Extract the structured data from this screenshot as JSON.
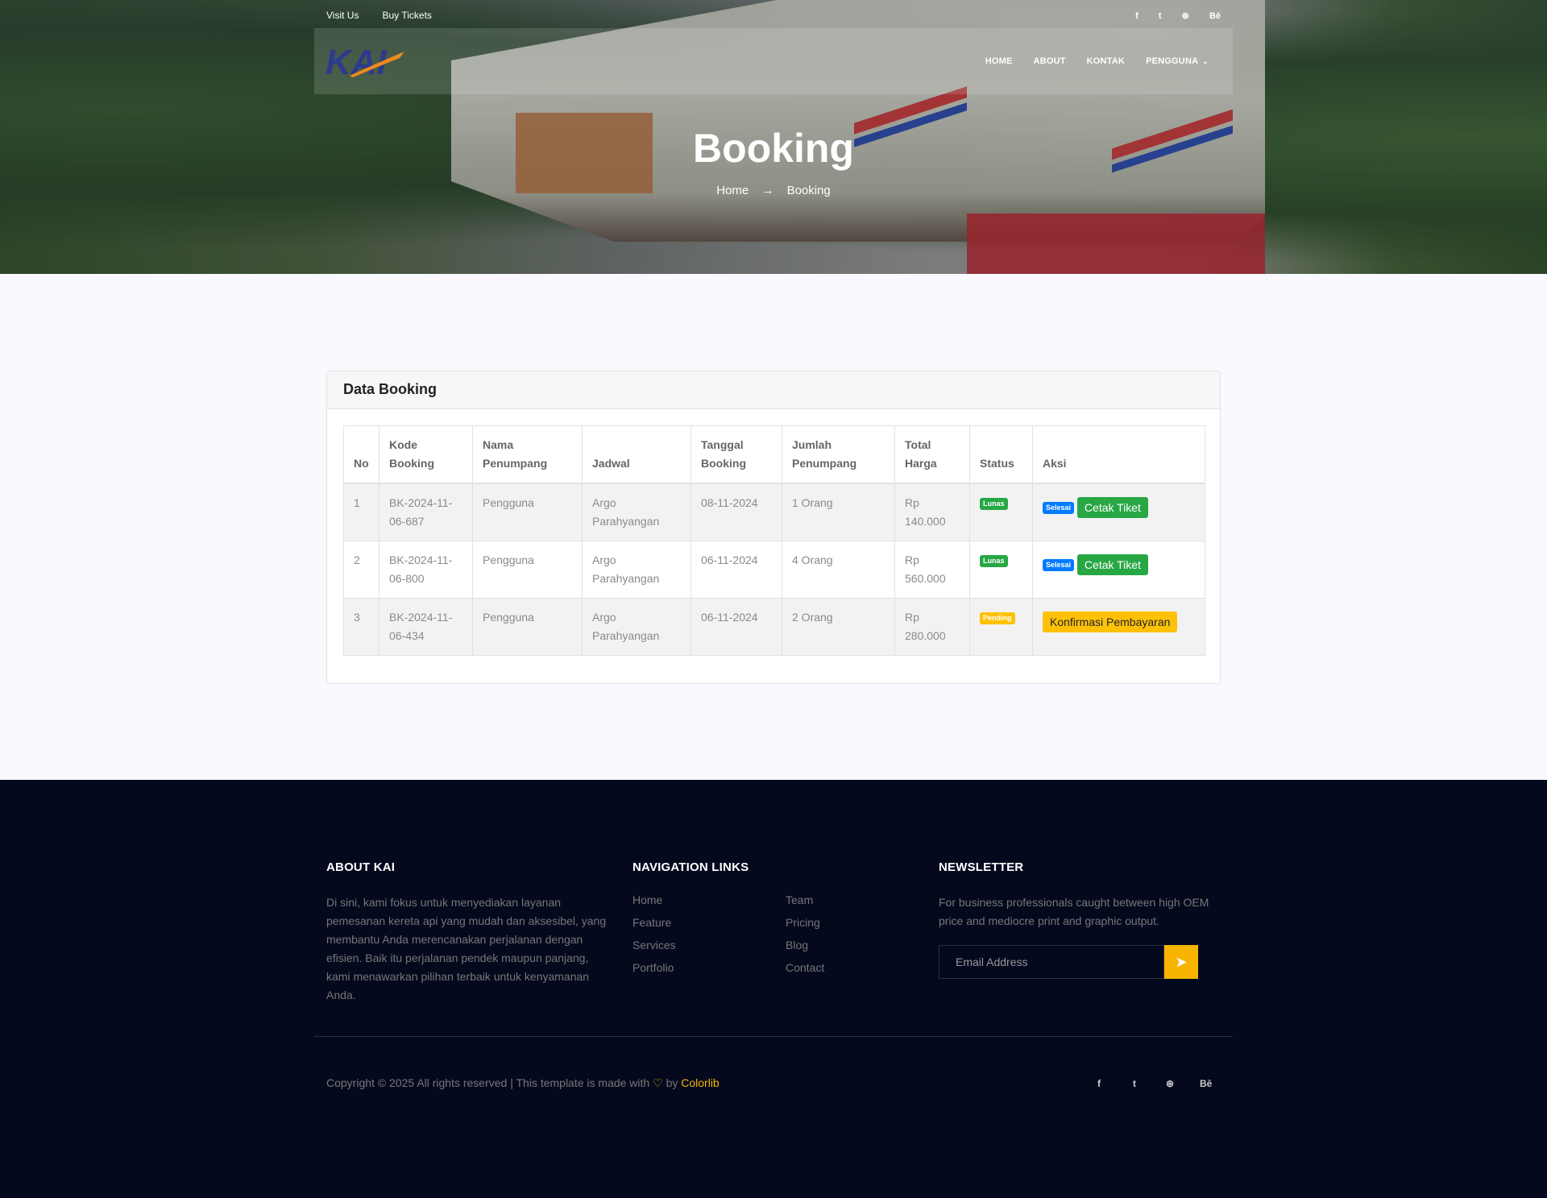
{
  "topbar": {
    "links": [
      "Visit Us",
      "Buy Tickets"
    ],
    "social": [
      {
        "icon": "facebook-icon",
        "glyph": "f"
      },
      {
        "icon": "twitter-icon",
        "glyph": "t"
      },
      {
        "icon": "dribbble-icon",
        "glyph": "⊛"
      },
      {
        "icon": "behance-icon",
        "glyph": "Bē"
      }
    ]
  },
  "nav": {
    "logo_text": "KAI",
    "items": [
      "HOME",
      "ABOUT",
      "KONTAK",
      "PENGGUNA"
    ]
  },
  "hero": {
    "title": "Booking",
    "breadcrumb_home": "Home",
    "breadcrumb_current": "Booking"
  },
  "card": {
    "title": "Data Booking",
    "columns": [
      "No",
      "Kode Booking",
      "Nama Penumpang",
      "Jadwal",
      "Tanggal Booking",
      "Jumlah Penumpang",
      "Total Harga",
      "Status",
      "Aksi"
    ],
    "rows": [
      {
        "no": "1",
        "kode": "BK-2024-11-06-687",
        "nama": "Pengguna",
        "jadwal": "Argo Parahyangan",
        "tanggal": "08-11-2024",
        "jumlah": "1 Orang",
        "harga": "Rp 140.000",
        "status": "Lunas",
        "status_color": "#28a745",
        "aksi_badge": "Selesai",
        "aksi_button": "Cetak Tiket"
      },
      {
        "no": "2",
        "kode": "BK-2024-11-06-800",
        "nama": "Pengguna",
        "jadwal": "Argo Parahyangan",
        "tanggal": "06-11-2024",
        "jumlah": "4 Orang",
        "harga": "Rp 560.000",
        "status": "Lunas",
        "status_color": "#28a745",
        "aksi_badge": "Selesai",
        "aksi_button": "Cetak Tiket"
      },
      {
        "no": "3",
        "kode": "BK-2024-11-06-434",
        "nama": "Pengguna",
        "jadwal": "Argo Parahyangan",
        "tanggal": "06-11-2024",
        "jumlah": "2 Orang",
        "harga": "Rp 280.000",
        "status": "Pending",
        "status_color": "#ffc107",
        "aksi_badge": "",
        "aksi_button": "Konfirmasi Pembayaran"
      }
    ]
  },
  "footer": {
    "about_title": "ABOUT KAI",
    "about_text": "Di sini, kami fokus untuk menyediakan layanan pemesanan kereta api yang mudah dan aksesibel, yang membantu Anda merencanakan perjalanan dengan efisien. Baik itu perjalanan pendek maupun panjang, kami menawarkan pilihan terbaik untuk kenyamanan Anda.",
    "nav_title": "NAVIGATION LINKS",
    "nav_links": [
      "Home",
      "Team",
      "Feature",
      "Pricing",
      "Services",
      "Blog",
      "Portfolio",
      "Contact"
    ],
    "newsletter_title": "NEWSLETTER",
    "newsletter_text": "For business professionals caught between high OEM price and mediocre print and graphic output.",
    "email_placeholder": "Email Address",
    "copyright_prefix": "Copyright © 2025 All rights reserved | This template is made with",
    "copyright_by": "by",
    "copyright_brand": "Colorlib"
  },
  "colors": {
    "accent": "#f7b500",
    "footer_bg": "#04091e",
    "success": "#28a745",
    "info": "#007bff",
    "warning": "#ffc107"
  }
}
